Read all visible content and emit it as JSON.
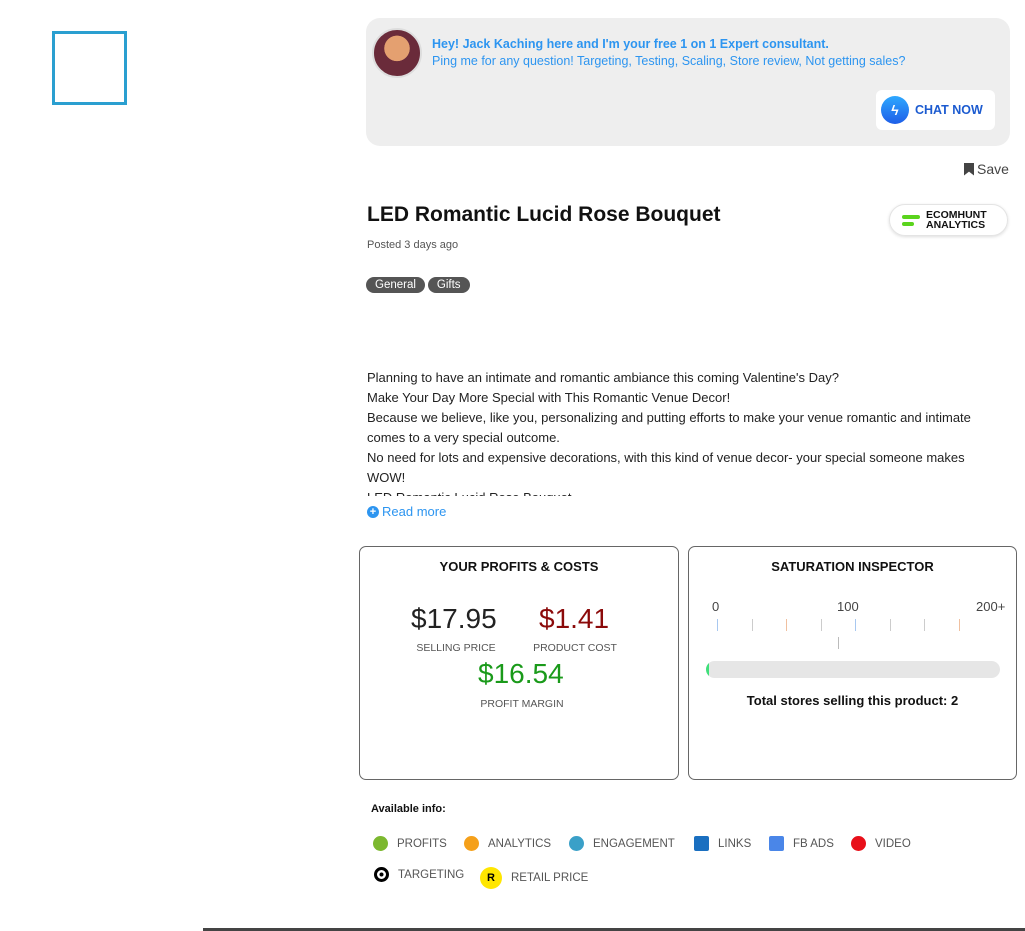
{
  "banner": {
    "line1": "Hey! Jack Kaching here and I'm your free 1 on 1 Expert consultant.",
    "line2": "Ping me for any question! Targeting, Testing, Scaling, Store review, Not getting sales?",
    "chat_label": "CHAT NOW"
  },
  "save_label": "Save",
  "product": {
    "title": "LED Romantic Lucid Rose Bouquet",
    "posted": "Posted 3 days ago",
    "tags": [
      "General",
      "Gifts"
    ],
    "description": [
      "Planning to have an intimate and romantic ambiance this coming Valentine's Day?",
      "Make Your Day More Special with This Romantic Venue Decor!",
      "Because we believe, like you, personalizing and putting efforts to make your venue romantic and intimate comes to a very special outcome.",
      "No need for lots and expensive decorations, with this kind of venue decor- your special someone makes WOW!",
      "LED Romantic Lucid Rose Bouquet"
    ],
    "read_more": "Read more"
  },
  "ecomhunt": {
    "line1": "ECOMHUNT",
    "line2": "ANALYTICS"
  },
  "profits": {
    "title": "YOUR PROFITS & COSTS",
    "selling_price": "$17.95",
    "selling_label": "SELLING PRICE",
    "product_cost": "$1.41",
    "cost_label": "PRODUCT COST",
    "margin": "$16.54",
    "margin_label": "PROFIT MARGIN",
    "colors": {
      "selling": "#222222",
      "cost": "#8b0a0a",
      "margin": "#1a9a1a"
    }
  },
  "saturation": {
    "title": "SATURATION INSPECTOR",
    "scale": [
      "0",
      "100",
      "200+"
    ],
    "stores_text": "Total stores selling this product: 2",
    "stores": 2,
    "fill_percent": 1
  },
  "available": {
    "label": "Available info:",
    "items": [
      {
        "label": "PROFITS",
        "icon": "dollar-icon",
        "color": "#7cb82f"
      },
      {
        "label": "ANALYTICS",
        "icon": "trend-icon",
        "color": "#f5a01a"
      },
      {
        "label": "ENGAGEMENT",
        "icon": "user-icon",
        "color": "#3aa0c8"
      },
      {
        "label": "LINKS",
        "icon": "link-icon",
        "color": "#1a6fc0"
      },
      {
        "label": "FB ADS",
        "icon": "bars-icon",
        "color": "#4a86e8"
      },
      {
        "label": "VIDEO",
        "icon": "play-icon",
        "color": "#e8101a"
      },
      {
        "label": "TARGETING",
        "icon": "target-icon",
        "color": "#000000"
      },
      {
        "label": "RETAIL PRICE",
        "icon": "r-badge-icon",
        "color": "#ffe600",
        "badge": "R"
      }
    ]
  }
}
